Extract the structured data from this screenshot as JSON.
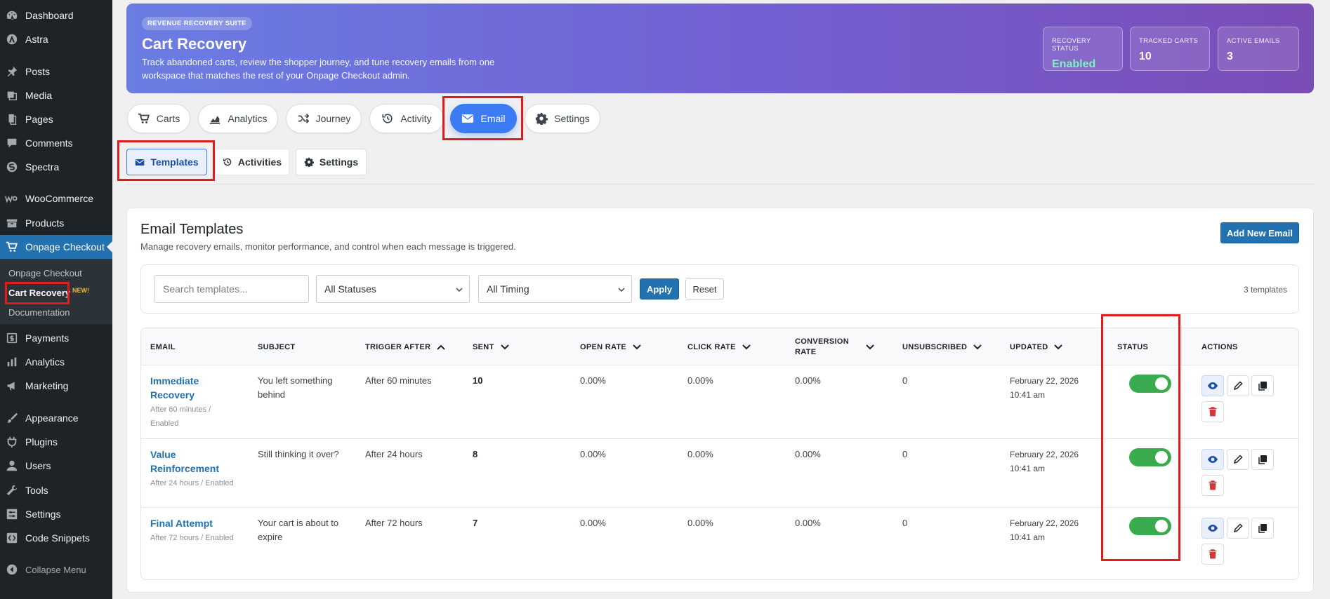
{
  "sidebar": {
    "items": [
      {
        "label": "Dashboard",
        "icon": "dashboard-icon"
      },
      {
        "label": "Astra",
        "icon": "astra-icon"
      },
      {
        "label": "Posts",
        "icon": "pin-icon"
      },
      {
        "label": "Media",
        "icon": "media-icon"
      },
      {
        "label": "Pages",
        "icon": "pages-icon"
      },
      {
        "label": "Comments",
        "icon": "comment-icon"
      },
      {
        "label": "Spectra",
        "icon": "spectra-icon"
      },
      {
        "label": "WooCommerce",
        "icon": "woo-icon"
      },
      {
        "label": "Products",
        "icon": "archive-icon"
      },
      {
        "label": "Onpage Checkout",
        "icon": "cart-icon"
      },
      {
        "label": "Payments",
        "icon": "dollar-icon"
      },
      {
        "label": "Analytics",
        "icon": "bar-chart-icon"
      },
      {
        "label": "Marketing",
        "icon": "megaphone-icon"
      },
      {
        "label": "Appearance",
        "icon": "brush-icon"
      },
      {
        "label": "Plugins",
        "icon": "plug-icon"
      },
      {
        "label": "Users",
        "icon": "user-icon"
      },
      {
        "label": "Tools",
        "icon": "wrench-icon"
      },
      {
        "label": "Settings",
        "icon": "settings-icon"
      },
      {
        "label": "Code Snippets",
        "icon": "code-icon"
      },
      {
        "label": "Collapse Menu",
        "icon": "collapse-icon"
      }
    ],
    "submenu": [
      {
        "label": "Onpage Checkout"
      },
      {
        "label": "Cart Recovery"
      },
      {
        "label": "Documentation"
      }
    ],
    "new_badge": "NEW!"
  },
  "hero": {
    "eyebrow": "REVENUE RECOVERY SUITE",
    "title": "Cart Recovery",
    "description": "Track abandoned carts, review the shopper journey, and tune recovery emails from one workspace that matches the rest of your Onpage Checkout admin.",
    "stats": [
      {
        "label": "RECOVERY STATUS",
        "value": "Enabled",
        "color": "#7ff0c4"
      },
      {
        "label": "TRACKED CARTS",
        "value": "10",
        "color": "#ffffff"
      },
      {
        "label": "ACTIVE EMAILS",
        "value": "3",
        "color": "#ffffff"
      }
    ]
  },
  "tabs": [
    {
      "label": "Carts",
      "icon": "cart-icon"
    },
    {
      "label": "Analytics",
      "icon": "chart-icon"
    },
    {
      "label": "Journey",
      "icon": "shuffle-icon"
    },
    {
      "label": "Activity",
      "icon": "history-icon"
    },
    {
      "label": "Email",
      "icon": "envelope-icon",
      "active": true
    },
    {
      "label": "Settings",
      "icon": "gear-icon"
    }
  ],
  "subtabs": [
    {
      "label": "Templates",
      "icon": "envelope-icon",
      "active": true
    },
    {
      "label": "Activities",
      "icon": "history-icon"
    },
    {
      "label": "Settings",
      "icon": "gear-icon"
    }
  ],
  "card": {
    "title": "Email Templates",
    "subtitle": "Manage recovery emails, monitor performance, and control when each message is triggered.",
    "add_button": "Add New Email"
  },
  "filters": {
    "search_placeholder": "Search templates...",
    "status_value": "All Statuses",
    "timing_value": "All Timing",
    "apply": "Apply",
    "reset": "Reset",
    "count": "3 templates"
  },
  "table": {
    "columns": [
      "EMAIL",
      "SUBJECT",
      "TRIGGER AFTER",
      "SENT",
      "OPEN RATE",
      "CLICK RATE",
      "CONVERSION RATE",
      "UNSUBSCRIBED",
      "UPDATED",
      "STATUS",
      "ACTIONS"
    ],
    "rows": [
      {
        "name": "Immediate Recovery",
        "meta": "After 60 minutes / Enabled",
        "subject": "You left something behind",
        "trigger": "After 60 minutes",
        "sent": "10",
        "open_rate": "0.00%",
        "click_rate": "0.00%",
        "conversion_rate": "0.00%",
        "unsubscribed": "0",
        "updated": "February 22, 2026 10:41 am",
        "enabled": true
      },
      {
        "name": "Value Reinforcement",
        "meta": "After 24 hours / Enabled",
        "subject": "Still thinking it over?",
        "trigger": "After 24 hours",
        "sent": "8",
        "open_rate": "0.00%",
        "click_rate": "0.00%",
        "conversion_rate": "0.00%",
        "unsubscribed": "0",
        "updated": "February 22, 2026 10:41 am",
        "enabled": true
      },
      {
        "name": "Final Attempt",
        "meta": "After 72 hours / Enabled",
        "subject": "Your cart is about to expire",
        "trigger": "After 72 hours",
        "sent": "7",
        "open_rate": "0.00%",
        "click_rate": "0.00%",
        "conversion_rate": "0.00%",
        "unsubscribed": "0",
        "updated": "February 22, 2026 10:41 am",
        "enabled": true
      }
    ]
  },
  "colors": {
    "wp_admin_blue": "#2271b1",
    "sidebar_bg": "#1d2327",
    "tab_active": "#3d7bf5",
    "toggle_on": "#3bab4f",
    "delete_red": "#d63638",
    "highlight_box": "#e21c1c"
  }
}
